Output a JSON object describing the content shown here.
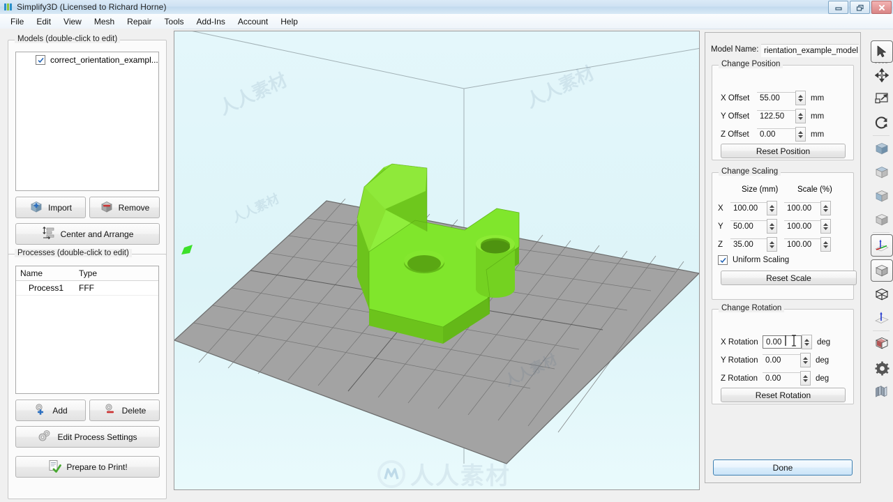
{
  "window": {
    "title": "Simplify3D (Licensed to Richard Horne)",
    "app_icon": "simplify3d-logo-icon",
    "buttons": {
      "minimize": "minimize-icon",
      "maximize": "restore-icon",
      "close": "close-icon"
    }
  },
  "menu": {
    "items": [
      "File",
      "Edit",
      "View",
      "Mesh",
      "Repair",
      "Tools",
      "Add-Ins",
      "Account",
      "Help"
    ]
  },
  "models_panel": {
    "title": "Models (double-click to edit)",
    "items": [
      {
        "label": "correct_orientation_exampl...",
        "checked": true
      }
    ],
    "buttons": {
      "import": "Import",
      "remove": "Remove",
      "center_arrange": "Center and Arrange"
    }
  },
  "processes_panel": {
    "title": "Processes (double-click to edit)",
    "columns": [
      "Name",
      "Type"
    ],
    "rows": [
      {
        "name": "Process1",
        "type": "FFF"
      }
    ],
    "buttons": {
      "add": "Add",
      "delete": "Delete",
      "edit_settings": "Edit Process Settings",
      "prepare": "Prepare to Print!"
    }
  },
  "model_settings": {
    "model_name_label": "Model Name:",
    "model_name_value": "rientation_example_model",
    "position": {
      "title": "Change Position",
      "rows": [
        {
          "label": "X Offset",
          "value": "55.00",
          "unit": "mm"
        },
        {
          "label": "Y Offset",
          "value": "122.50",
          "unit": "mm"
        },
        {
          "label": "Z Offset",
          "value": "0.00",
          "unit": "mm"
        }
      ],
      "reset": "Reset Position"
    },
    "scaling": {
      "title": "Change Scaling",
      "col_size": "Size (mm)",
      "col_scale": "Scale (%)",
      "rows": [
        {
          "axis": "X",
          "size": "100.00",
          "scale": "100.00"
        },
        {
          "axis": "Y",
          "size": "50.00",
          "scale": "100.00"
        },
        {
          "axis": "Z",
          "size": "35.00",
          "scale": "100.00"
        }
      ],
      "uniform_label": "Uniform Scaling",
      "uniform_checked": true,
      "reset": "Reset Scale"
    },
    "rotation": {
      "title": "Change Rotation",
      "rows": [
        {
          "label": "X Rotation",
          "value": "0.00",
          "unit": "deg",
          "focused": true
        },
        {
          "label": "Y Rotation",
          "value": "0.00",
          "unit": "deg"
        },
        {
          "label": "Z Rotation",
          "value": "0.00",
          "unit": "deg"
        }
      ],
      "reset": "Reset Rotation"
    },
    "done": "Done"
  },
  "toolbar": {
    "tools": [
      {
        "name": "select-arrow-tool",
        "selected": true
      },
      {
        "name": "move-tool",
        "selected": false
      },
      {
        "name": "scale-tool",
        "selected": false
      },
      {
        "name": "rotate-tool",
        "selected": false
      },
      {
        "name": "view-front-cube",
        "selected": false
      },
      {
        "name": "view-top-cube",
        "selected": false
      },
      {
        "name": "view-side-cube",
        "selected": false
      },
      {
        "name": "view-iso-cube",
        "selected": false
      },
      {
        "name": "axis-origin-view",
        "selected": false
      },
      {
        "name": "solid-model-view",
        "selected": true
      },
      {
        "name": "wireframe-view",
        "selected": false
      },
      {
        "name": "normals-view",
        "selected": false
      },
      {
        "name": "cross-section-view",
        "selected": false
      },
      {
        "name": "settings-gear",
        "selected": false
      },
      {
        "name": "layers-view",
        "selected": false
      }
    ]
  },
  "viewport": {
    "model_color": "#77e025",
    "plate_color": "#a3a3a3",
    "background_top": "#e4f7fb",
    "origin_marker_color": "#3ce02a"
  },
  "watermark": {
    "text": "人人素材",
    "mark": "M"
  }
}
